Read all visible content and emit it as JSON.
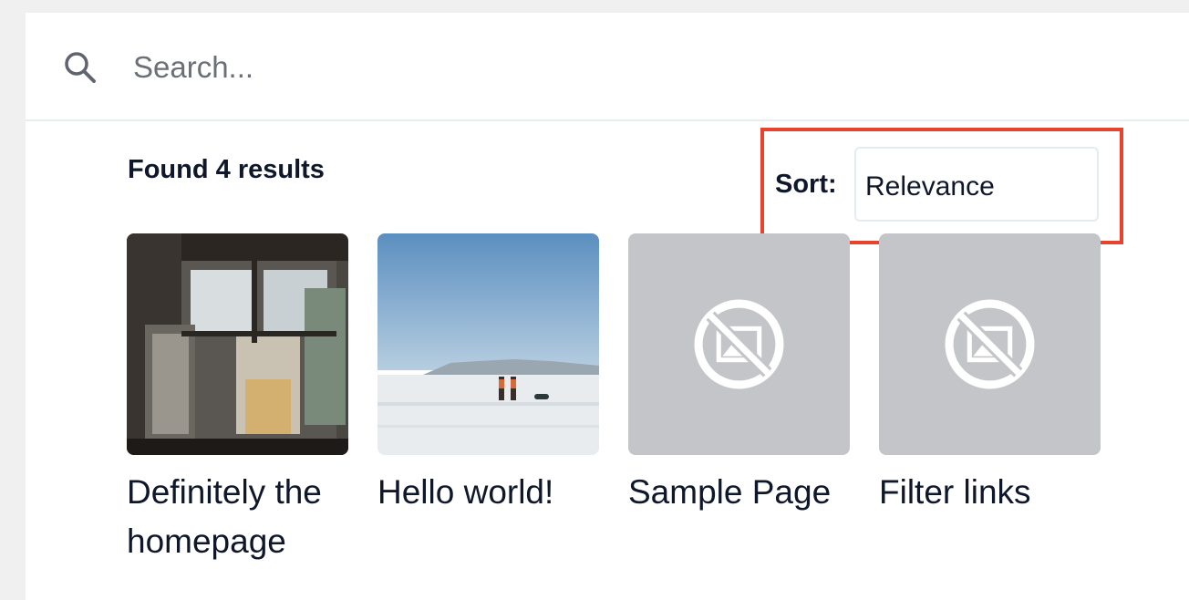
{
  "search": {
    "placeholder": "Search...",
    "value": ""
  },
  "results": {
    "count_text": "Found 4 results"
  },
  "sort": {
    "label": "Sort:",
    "selected": "Relevance"
  },
  "cards": [
    {
      "title": "Definitely the homepage",
      "thumbnail": "window-photo"
    },
    {
      "title": "Hello world!",
      "thumbnail": "snowfield-photo"
    },
    {
      "title": "Sample Page",
      "thumbnail": "no-image-icon"
    },
    {
      "title": "Filter links",
      "thumbnail": "no-image-icon"
    }
  ],
  "colors": {
    "highlight": "#e8432e",
    "placeholder_bg": "#c4c5c9",
    "text": "#0f172a"
  }
}
